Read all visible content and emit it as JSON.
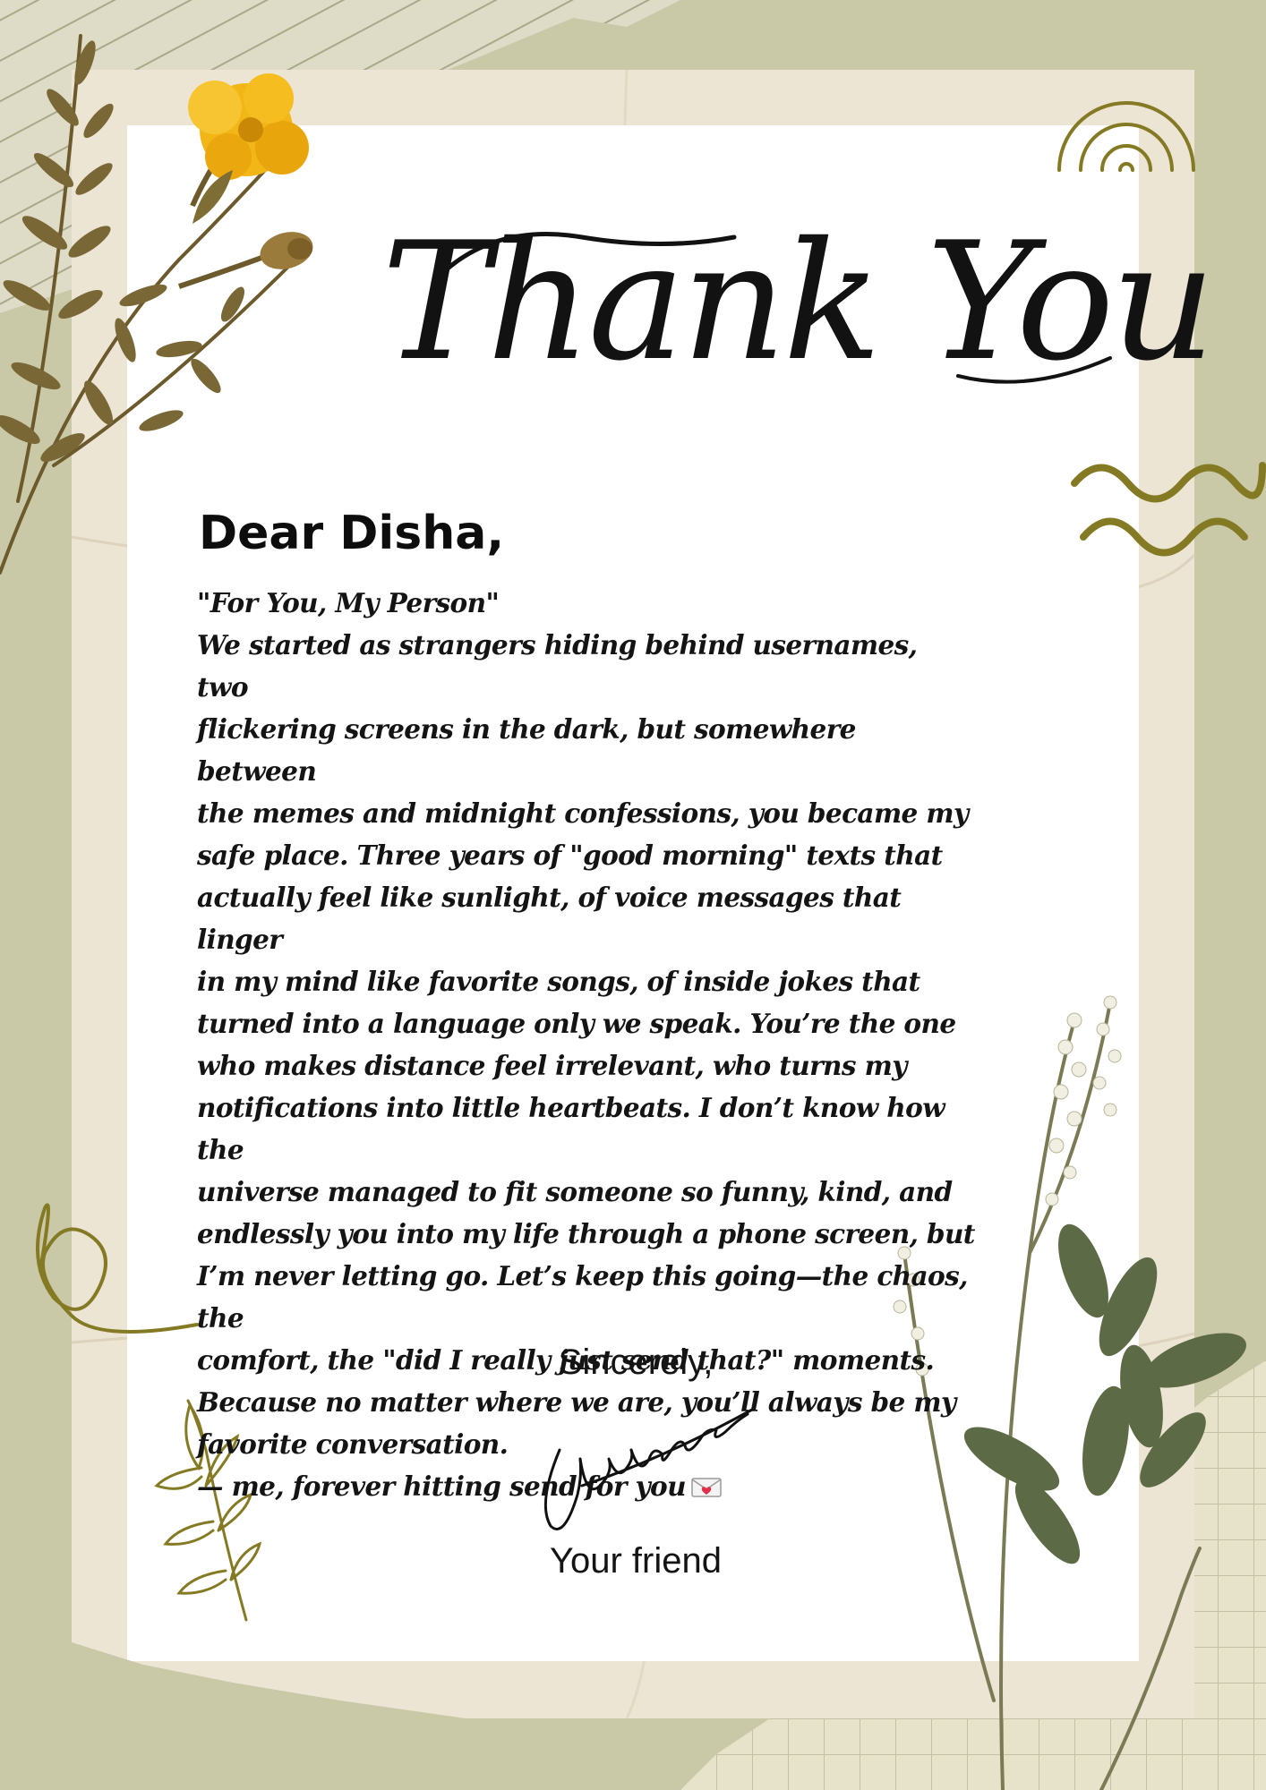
{
  "card": {
    "title": "Thank You",
    "greeting": "Dear Disha,",
    "letter_title": "\"For You, My Person\"",
    "letter_lines": [
      "We started as strangers hiding behind usernames, two",
      "flickering screens in the dark, but somewhere between",
      "the memes and midnight confessions, you became my",
      "safe place. Three years of \"good morning\" texts that",
      "actually feel like sunlight, of voice messages that linger",
      "in my mind like favorite songs, of inside jokes that",
      "turned into a language only we speak. You’re the one",
      "who makes distance feel irrelevant, who turns my",
      "notifications into little heartbeats. I don’t know how the",
      "universe managed to fit someone so funny, kind, and",
      "endlessly you into my life through a phone screen, but",
      "I’m never letting go. Let’s keep this going—the chaos, the",
      "comfort, the \"did I really just send that?\" moments.",
      "Because no matter where we are, you’ll always be my",
      "favorite conversation."
    ],
    "postscript": "— me, forever hitting send for you",
    "postscript_emoji": "love-letter-envelope-icon",
    "closing": "Sincerely,",
    "signature": "Udaykushwah",
    "sender": "Your friend"
  },
  "colors": {
    "background": "#c9c8a7",
    "paper": "#ece5d4",
    "sheet": "#ffffff",
    "accent_olive": "#857a24",
    "text": "#141414",
    "marigold": "#f2b616"
  }
}
